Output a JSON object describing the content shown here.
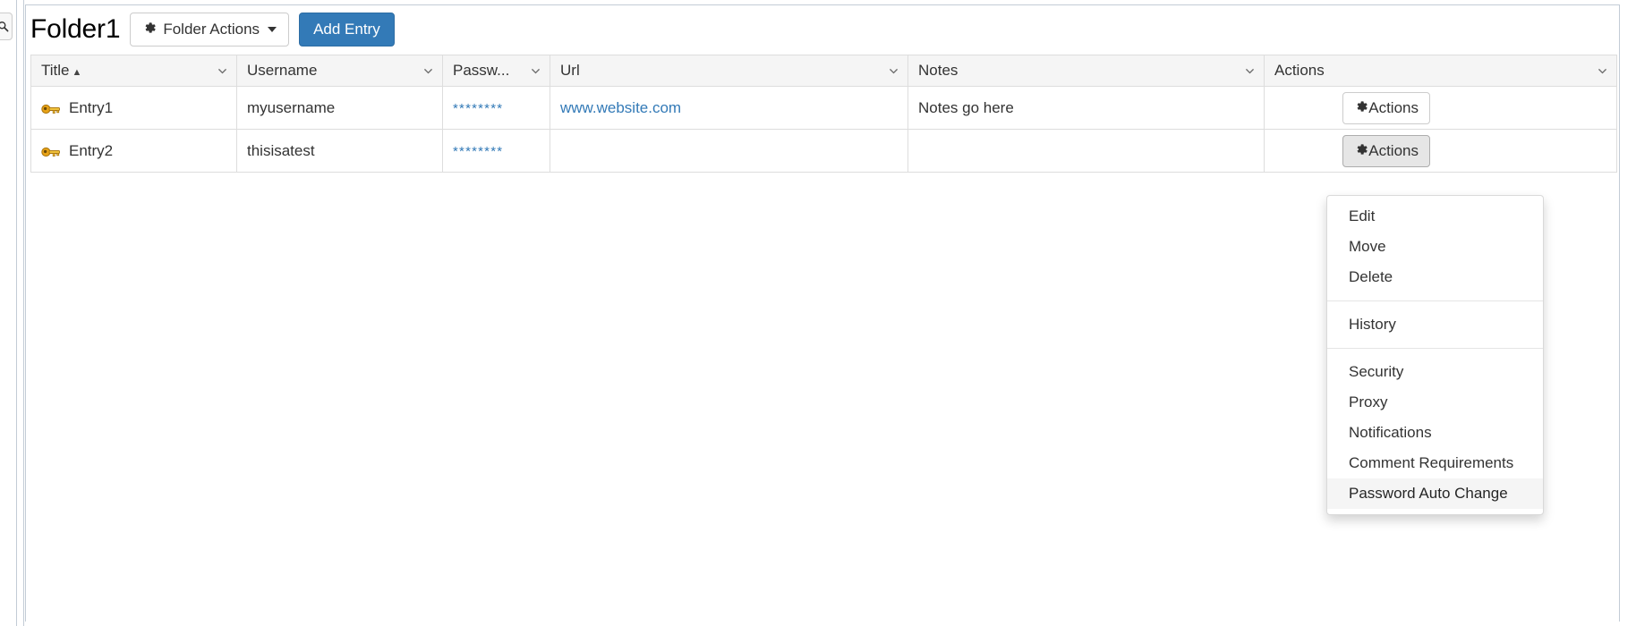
{
  "left_rail": {
    "search_button_icon": "search-icon"
  },
  "toolbar": {
    "folder_title": "Folder1",
    "folder_actions_label": "Folder Actions",
    "folder_actions_icon": "gear-icon",
    "add_entry_label": "Add Entry",
    "accent_color": "#337ab7"
  },
  "table": {
    "columns": [
      {
        "label": "Title",
        "sort": "asc",
        "has_caret": true
      },
      {
        "label": "Username",
        "sort": "",
        "has_caret": true
      },
      {
        "label": "Passw...",
        "sort": "",
        "has_caret": true
      },
      {
        "label": "Url",
        "sort": "",
        "has_caret": true
      },
      {
        "label": "Notes",
        "sort": "",
        "has_caret": true
      },
      {
        "label": "Actions",
        "sort": "",
        "has_caret": true
      }
    ],
    "sort_asc_glyph": "▲",
    "rows": [
      {
        "icon": "key-icon",
        "title": "Entry1",
        "username": "myusername",
        "password_mask": "********",
        "url": "www.website.com",
        "notes": "Notes go here",
        "action_label": "Actions",
        "action_icon": "gear-icon",
        "action_active": false
      },
      {
        "icon": "key-icon",
        "title": "Entry2",
        "username": "thisisatest",
        "password_mask": "********",
        "url": "",
        "notes": "",
        "action_label": "Actions",
        "action_icon": "gear-icon",
        "action_active": true
      }
    ]
  },
  "dropdown": {
    "open": true,
    "items": [
      {
        "label": "Edit",
        "type": "item",
        "hovered": false
      },
      {
        "label": "Move",
        "type": "item",
        "hovered": false
      },
      {
        "label": "Delete",
        "type": "item",
        "hovered": false
      },
      {
        "label": "",
        "type": "separator",
        "hovered": false
      },
      {
        "label": "History",
        "type": "item",
        "hovered": false
      },
      {
        "label": "",
        "type": "separator",
        "hovered": false
      },
      {
        "label": "Security",
        "type": "item",
        "hovered": false
      },
      {
        "label": "Proxy",
        "type": "item",
        "hovered": false
      },
      {
        "label": "Notifications",
        "type": "item",
        "hovered": false
      },
      {
        "label": "Comment Requirements",
        "type": "item",
        "hovered": false
      },
      {
        "label": "Password Auto Change",
        "type": "item",
        "hovered": true
      }
    ]
  }
}
